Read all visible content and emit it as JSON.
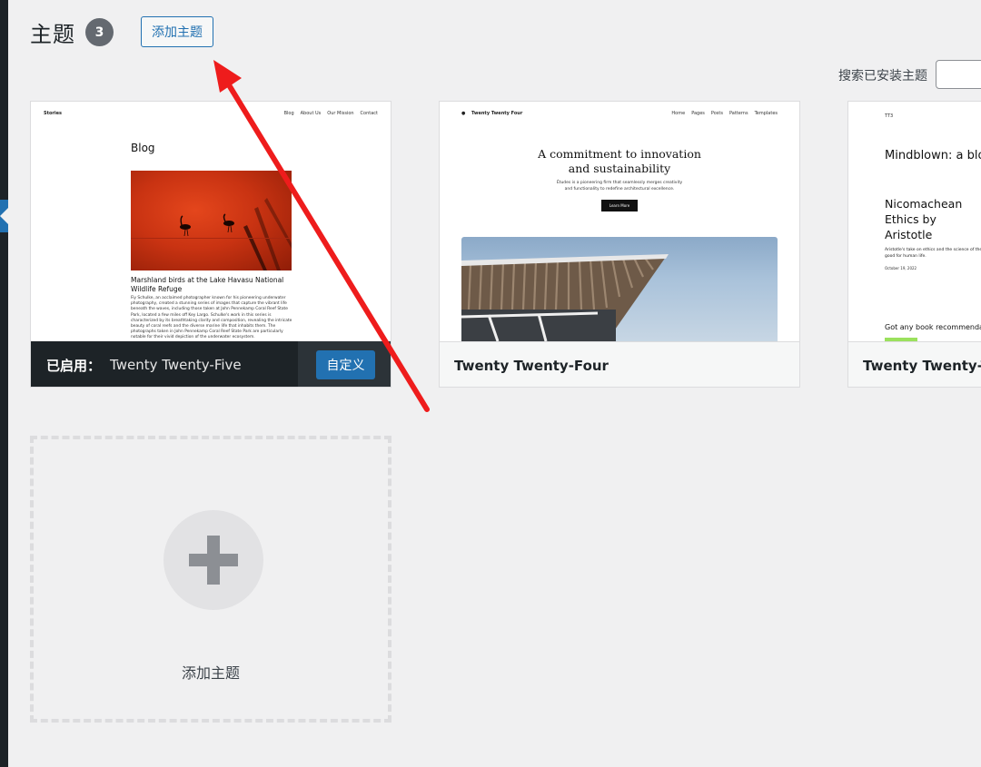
{
  "header": {
    "title": "主题",
    "count": "3",
    "add_button_label": "添加主题"
  },
  "search": {
    "label": "搜索已安装主题",
    "placeholder": ""
  },
  "themes": [
    {
      "name": "Twenty Twenty-Five",
      "active": true,
      "active_label": "已启用：",
      "customize_label": "自定义",
      "preview": {
        "site_title": "Stories",
        "nav": [
          "Blog",
          "About Us",
          "Our Mission",
          "Contact"
        ],
        "page_heading": "Blog",
        "post_title": "Marshland birds at the Lake Havasu National Wildlife Refuge",
        "post_body": "Fiy Schulke, an acclaimed photographer known for his pioneering underwater photography, created a stunning series of images that capture the vibrant life beneath the waves, including those taken at John Pennekamp Coral Reef State Park, located a few miles off Key Largo. Schulke's work in this series is characterized by its breathtaking clarity and composition, revealing the intricate beauty of coral reefs and the diverse marine life that inhabits them. The photographs taken in John Pennekamp Coral Reef State Park are particularly notable for their vivid depiction of the underwater ecosystem."
      }
    },
    {
      "name": "Twenty Twenty-Four",
      "active": false,
      "preview": {
        "site_title": "Twenty Twenty Four",
        "nav": [
          "Home",
          "Pages",
          "Posts",
          "Patterns",
          "Templates"
        ],
        "heading_line1": "A commitment to innovation",
        "heading_line2": "and sustainability",
        "sub_line1": "Études is a pioneering firm that seamlessly merges creativity",
        "sub_line2": "and functionality to redefine architectural excellence.",
        "button": "Learn More"
      }
    },
    {
      "name": "Twenty Twenty-Th",
      "active": false,
      "preview": {
        "logo": "TT3",
        "title": "Mindblown: a blo",
        "post_line1": "Nicomachean",
        "post_line2": "Ethics by",
        "post_line3": "Aristotle",
        "excerpt": "Aristotle's take on ethics and the science of the good for human life.",
        "date": "October 19, 2022",
        "footer_text": "Got any book recommenda"
      }
    }
  ],
  "add_tile": {
    "label": "添加主题"
  },
  "colors": {
    "accent": "#2271b1",
    "dark_bar": "#1d2327",
    "badge": "#646970",
    "annotation_arrow": "#ee1c1c"
  }
}
